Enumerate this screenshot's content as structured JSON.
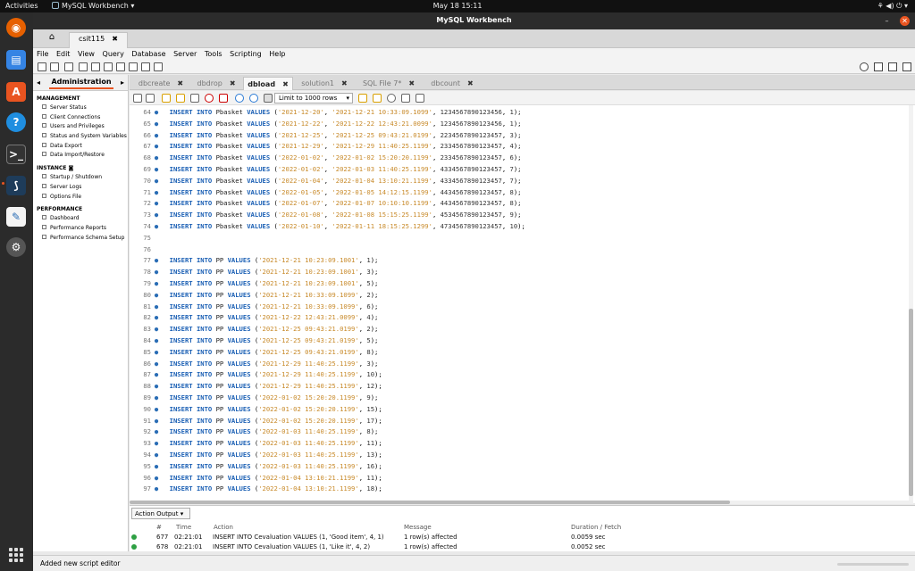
{
  "topbar": {
    "activities": "Activities",
    "app_menu": "MySQL Workbench ▾",
    "clock": "May 18  15:11",
    "tray": "⚘ ◀) ⏻ ▾"
  },
  "window": {
    "title": "MySQL Workbench",
    "minimize": "–",
    "close": "✕"
  },
  "connection_tab": {
    "label": "csit115",
    "close": "✖"
  },
  "menu": [
    "File",
    "Edit",
    "View",
    "Query",
    "Database",
    "Server",
    "Tools",
    "Scripting",
    "Help"
  ],
  "navigator": {
    "header": "Administration",
    "sections": [
      {
        "title": "MANAGEMENT",
        "items": [
          "Server Status",
          "Client Connections",
          "Users and Privileges",
          "Status and System Variables",
          "Data Export",
          "Data Import/Restore"
        ]
      },
      {
        "title": "INSTANCE",
        "items": [
          "Startup / Shutdown",
          "Server Logs",
          "Options File"
        ]
      },
      {
        "title": "PERFORMANCE",
        "items": [
          "Dashboard",
          "Performance Reports",
          "Performance Schema Setup"
        ]
      }
    ]
  },
  "editor_tabs": [
    "dbcreate",
    "dbdrop",
    "dbload",
    "solution1",
    "SQL File 7*",
    "dbcount"
  ],
  "active_tab": "dbload",
  "sql_toolbar": {
    "limit": "Limit to 1000 rows"
  },
  "code_lines": [
    {
      "n": "64",
      "dot": true,
      "table": "Pbasket",
      "vals": [
        "'2021-12-20'",
        "'2021-12-21 10:33:09.1099'",
        "1234567890123456",
        "1"
      ]
    },
    {
      "n": "65",
      "dot": true,
      "table": "Pbasket",
      "vals": [
        "'2021-12-22'",
        "'2021-12-22 12:43:21.0099'",
        "1234567890123456",
        "1"
      ]
    },
    {
      "n": "66",
      "dot": true,
      "table": "Pbasket",
      "vals": [
        "'2021-12-25'",
        "'2021-12-25 09:43:21.0199'",
        "2234567890123457",
        "3"
      ]
    },
    {
      "n": "67",
      "dot": true,
      "table": "Pbasket",
      "vals": [
        "'2021-12-29'",
        "'2021-12-29 11:40:25.1199'",
        "2334567890123457",
        "4"
      ]
    },
    {
      "n": "68",
      "dot": true,
      "table": "Pbasket",
      "vals": [
        "'2022-01-02'",
        "'2022-01-02 15:20:20.1199'",
        "2334567890123457",
        "6"
      ]
    },
    {
      "n": "69",
      "dot": true,
      "table": "Pbasket",
      "vals": [
        "'2022-01-02'",
        "'2022-01-03 11:40:25.1199'",
        "4334567890123457",
        "7"
      ]
    },
    {
      "n": "70",
      "dot": true,
      "table": "Pbasket",
      "vals": [
        "'2022-01-04'",
        "'2022-01-04 13:10:21.1199'",
        "4334567890123457",
        "7"
      ]
    },
    {
      "n": "71",
      "dot": true,
      "table": "Pbasket",
      "vals": [
        "'2022-01-05'",
        "'2022-01-05 14:12:15.1199'",
        "4434567890123457",
        "8"
      ]
    },
    {
      "n": "72",
      "dot": true,
      "table": "Pbasket",
      "vals": [
        "'2022-01-07'",
        "'2022-01-07 10:10:10.1199'",
        "4434567890123457",
        "8"
      ]
    },
    {
      "n": "73",
      "dot": true,
      "table": "Pbasket",
      "vals": [
        "'2022-01-08'",
        "'2022-01-08 15:15:25.1199'",
        "4534567890123457",
        "9"
      ]
    },
    {
      "n": "74",
      "dot": true,
      "table": "Pbasket",
      "vals": [
        "'2022-01-10'",
        "'2022-01-11 18:15:25.1299'",
        "4734567890123457",
        "10"
      ]
    },
    {
      "n": "75",
      "dot": false
    },
    {
      "n": "76",
      "dot": false
    },
    {
      "n": "77",
      "dot": true,
      "table": "PP",
      "vals": [
        "'2021-12-21 10:23:09.1001'",
        "1"
      ]
    },
    {
      "n": "78",
      "dot": true,
      "table": "PP",
      "vals": [
        "'2021-12-21 10:23:09.1001'",
        "3"
      ]
    },
    {
      "n": "79",
      "dot": true,
      "table": "PP",
      "vals": [
        "'2021-12-21 10:23:09.1001'",
        "5"
      ]
    },
    {
      "n": "80",
      "dot": true,
      "table": "PP",
      "vals": [
        "'2021-12-21 10:33:09.1099'",
        "2"
      ]
    },
    {
      "n": "81",
      "dot": true,
      "table": "PP",
      "vals": [
        "'2021-12-21 10:33:09.1099'",
        "6"
      ]
    },
    {
      "n": "82",
      "dot": true,
      "table": "PP",
      "vals": [
        "'2021-12-22 12:43:21.0099'",
        "4"
      ]
    },
    {
      "n": "83",
      "dot": true,
      "table": "PP",
      "vals": [
        "'2021-12-25 09:43:21.0199'",
        "2"
      ]
    },
    {
      "n": "84",
      "dot": true,
      "table": "PP",
      "vals": [
        "'2021-12-25 09:43:21.0199'",
        "5"
      ]
    },
    {
      "n": "85",
      "dot": true,
      "table": "PP",
      "vals": [
        "'2021-12-25 09:43:21.0199'",
        "8"
      ]
    },
    {
      "n": "86",
      "dot": true,
      "table": "PP",
      "vals": [
        "'2021-12-29 11:40:25.1199'",
        "3"
      ]
    },
    {
      "n": "87",
      "dot": true,
      "table": "PP",
      "vals": [
        "'2021-12-29 11:40:25.1199'",
        "10"
      ]
    },
    {
      "n": "88",
      "dot": true,
      "table": "PP",
      "vals": [
        "'2021-12-29 11:40:25.1199'",
        "12"
      ]
    },
    {
      "n": "89",
      "dot": true,
      "table": "PP",
      "vals": [
        "'2022-01-02 15:20:20.1199'",
        "9"
      ]
    },
    {
      "n": "90",
      "dot": true,
      "table": "PP",
      "vals": [
        "'2022-01-02 15:20:20.1199'",
        "15"
      ]
    },
    {
      "n": "91",
      "dot": true,
      "table": "PP",
      "vals": [
        "'2022-01-02 15:20:20.1199'",
        "17"
      ]
    },
    {
      "n": "92",
      "dot": true,
      "table": "PP",
      "vals": [
        "'2022-01-03 11:40:25.1199'",
        "8"
      ]
    },
    {
      "n": "93",
      "dot": true,
      "table": "PP",
      "vals": [
        "'2022-01-03 11:40:25.1199'",
        "11"
      ]
    },
    {
      "n": "94",
      "dot": true,
      "table": "PP",
      "vals": [
        "'2022-01-03 11:40:25.1199'",
        "13"
      ]
    },
    {
      "n": "95",
      "dot": true,
      "table": "PP",
      "vals": [
        "'2022-01-03 11:40:25.1199'",
        "16"
      ]
    },
    {
      "n": "96",
      "dot": true,
      "table": "PP",
      "vals": [
        "'2022-01-04 13:10:21.1199'",
        "11"
      ]
    },
    {
      "n": "97",
      "dot": true,
      "table": "PP",
      "vals": [
        "'2022-01-04 13:10:21.1199'",
        "18"
      ]
    }
  ],
  "keywords": {
    "insert": "INSERT",
    "into": "INTO",
    "values": "VALUES"
  },
  "output": {
    "selector": "Action Output",
    "columns": [
      "#",
      "Time",
      "Action",
      "Message",
      "Duration / Fetch"
    ],
    "rows": [
      {
        "num": "677",
        "time": "02:21:01",
        "action": "INSERT INTO Cevaluation VALUES (1, 'Good item', 4, 1)",
        "message": "1 row(s) affected",
        "duration": "0.0059 sec"
      },
      {
        "num": "678",
        "time": "02:21:01",
        "action": "INSERT INTO Cevaluation VALUES (1, 'Like it', 4, 2)",
        "message": "1 row(s) affected",
        "duration": "0.0052 sec"
      }
    ]
  },
  "status": "Added new script editor",
  "colors": {
    "accent": "#e95420",
    "keyword": "#1a5fb4",
    "string": "#c88a2a",
    "ok": "#2ea043"
  }
}
